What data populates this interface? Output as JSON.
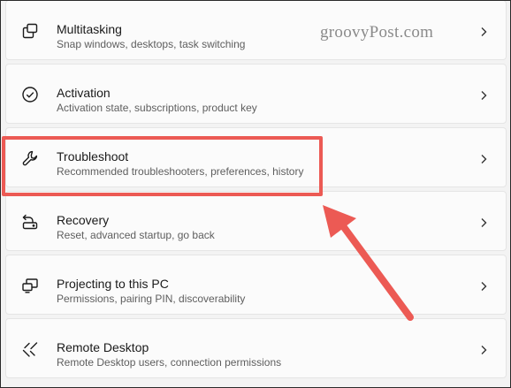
{
  "watermark": "groovyPost.com",
  "items": [
    {
      "title": "Multitasking",
      "subtitle": "Snap windows, desktops, task switching",
      "icon": "multitasking-icon"
    },
    {
      "title": "Activation",
      "subtitle": "Activation state, subscriptions, product key",
      "icon": "activation-check-icon"
    },
    {
      "title": "Troubleshoot",
      "subtitle": "Recommended troubleshooters, preferences, history",
      "icon": "wrench-icon"
    },
    {
      "title": "Recovery",
      "subtitle": "Reset, advanced startup, go back",
      "icon": "recovery-icon"
    },
    {
      "title": "Projecting to this PC",
      "subtitle": "Permissions, pairing PIN, discoverability",
      "icon": "projecting-icon"
    },
    {
      "title": "Remote Desktop",
      "subtitle": "Remote Desktop users, connection permissions",
      "icon": "remote-desktop-icon"
    }
  ],
  "colors": {
    "highlight": "#ec5a54",
    "card_background": "#fbfbfb",
    "page_background": "#f3f3f3"
  }
}
